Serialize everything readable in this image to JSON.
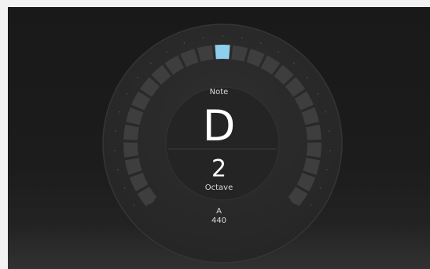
{
  "tuner": {
    "note_label": "Note",
    "note": "D",
    "octave": "2",
    "octave_label": "Octave",
    "reference_note": "A",
    "reference_frequency": "440",
    "segments_total": 25,
    "active_segment_index": 12,
    "colors": {
      "active": "#8fcfee",
      "segment": "#3e3e3e",
      "dial": "#2a2a2a"
    }
  }
}
